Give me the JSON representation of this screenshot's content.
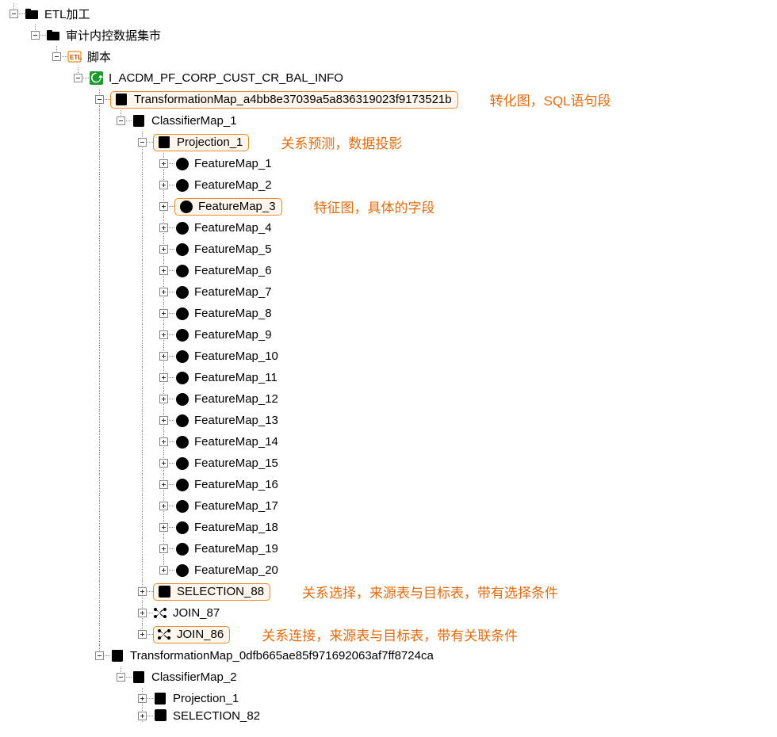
{
  "root": {
    "label": "ETL加工",
    "child": {
      "label": "审计内控数据集市",
      "child": {
        "label": "脚本",
        "child": {
          "label": "I_ACDM_PF_CORP_CUST_CR_BAL_INFO",
          "tmap1": {
            "label": "TransformationMap_a4bb8e37039a5a836319023f9173521b",
            "anno": "转化图，SQL语句段",
            "classifier": {
              "label": "ClassifierMap_1",
              "projection": {
                "label": "Projection_1",
                "anno": "关系预测，数据投影",
                "features": [
                  "FeatureMap_1",
                  "FeatureMap_2",
                  "FeatureMap_3",
                  "FeatureMap_4",
                  "FeatureMap_5",
                  "FeatureMap_6",
                  "FeatureMap_7",
                  "FeatureMap_8",
                  "FeatureMap_9",
                  "FeatureMap_10",
                  "FeatureMap_11",
                  "FeatureMap_12",
                  "FeatureMap_13",
                  "FeatureMap_14",
                  "FeatureMap_15",
                  "FeatureMap_16",
                  "FeatureMap_17",
                  "FeatureMap_18",
                  "FeatureMap_19",
                  "FeatureMap_20"
                ],
                "feature_hl_index": 2,
                "feature_anno": "特征图，具体的字段"
              },
              "selection": {
                "label": "SELECTION_88",
                "anno": "关系选择，来源表与目标表，带有选择条件"
              },
              "join87": {
                "label": "JOIN_87"
              },
              "join86": {
                "label": "JOIN_86",
                "anno": "关系连接，来源表与目标表，带有关联条件"
              }
            }
          },
          "tmap2": {
            "label": "TransformationMap_0dfb665ae85f971692063af7ff8724ca",
            "classifier": {
              "label": "ClassifierMap_2",
              "projection": {
                "label": "Projection_1"
              },
              "selection": {
                "label": "SELECTION_82"
              }
            }
          }
        }
      }
    }
  }
}
